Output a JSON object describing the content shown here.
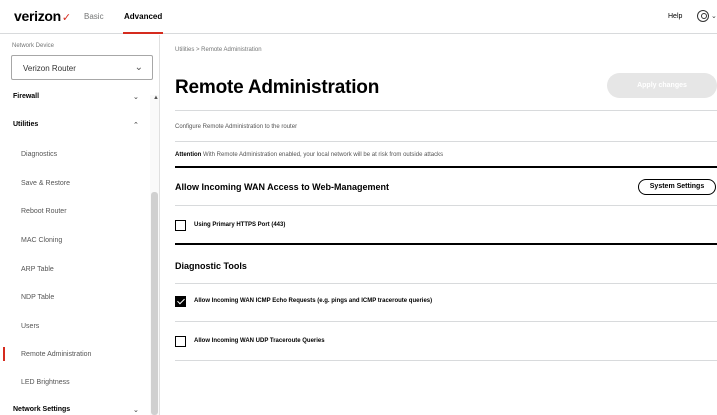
{
  "header": {
    "logo_text": "verizon",
    "logo_mark": "✓",
    "tabs": [
      {
        "label": "Basic",
        "active": false
      },
      {
        "label": "Advanced",
        "active": true
      }
    ],
    "help_label": "Help",
    "user_icon": "user-circle-icon",
    "accent_color": "#d52b1e"
  },
  "sidebar": {
    "device_label": "Network Device",
    "device_value": "Verizon Router",
    "sections": [
      {
        "label": "Firewall"
      },
      {
        "label": "Utilities"
      },
      {
        "label": "Network Settings"
      }
    ],
    "utilities_items": [
      {
        "label": "Diagnostics"
      },
      {
        "label": "Save & Restore"
      },
      {
        "label": "Reboot Router"
      },
      {
        "label": "MAC Cloning"
      },
      {
        "label": "ARP Table"
      },
      {
        "label": "NDP Table"
      },
      {
        "label": "Users"
      },
      {
        "label": "Remote Administration",
        "active": true
      },
      {
        "label": "LED Brightness"
      }
    ]
  },
  "main": {
    "breadcrumb": "Utilities > Remote Administration",
    "title": "Remote Administration",
    "apply_label": "Apply changes",
    "description": "Configure Remote Administration to the router",
    "attention_bold": "Attention",
    "attention_text": "With Remote Administration enabled, your local network will be at risk from outside attacks",
    "wan_heading": "Allow Incoming WAN Access to Web-Management",
    "system_settings_label": "System Settings",
    "https_label": "Using Primary HTTPS Port (443)",
    "https_checked": false,
    "diag_heading": "Diagnostic Tools",
    "icmp_label": "Allow Incoming WAN ICMP Echo Requests (e.g. pings and ICMP traceroute queries)",
    "icmp_checked": true,
    "udp_label": "Allow Incoming WAN UDP Traceroute Queries",
    "udp_checked": false
  }
}
